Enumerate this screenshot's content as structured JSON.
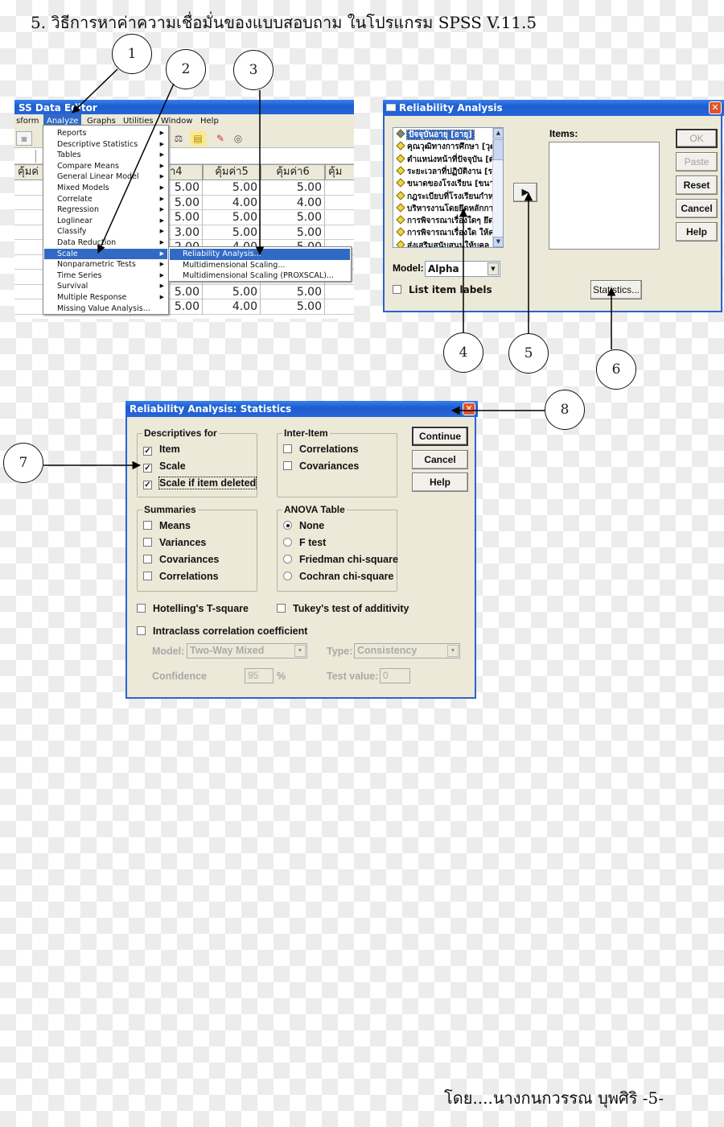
{
  "heading": "5.  วิธีการหาค่าความเชื่อมั่นของแบบสอบถาม  ในโปรแกรม SPSS V.11.5",
  "footer": "โดย....นางกนกวรรณ  บุพศิริ  -5-",
  "callouts": [
    "1",
    "2",
    "3",
    "4",
    "5",
    "6",
    "7",
    "8"
  ],
  "data_editor": {
    "title": "SS Data Editor",
    "menubar": [
      "sform",
      "Analyze",
      "Graphs",
      "Utilities",
      "Window",
      "Help"
    ],
    "active_menu": "Analyze",
    "toolbar_icons": [
      "chart-icon",
      "scale-balance-icon",
      "grid-table-icon",
      "value-labels-icon",
      "sets-icon"
    ],
    "columns": [
      "คุ้มค่",
      "า4",
      "คุ้มค่า5",
      "คุ้มค่า6",
      "คุ้ม"
    ],
    "rows": [
      [
        "5.00",
        "5.00",
        "5.00"
      ],
      [
        "5.00",
        "4.00",
        "4.00"
      ],
      [
        "5.00",
        "5.00",
        "5.00"
      ],
      [
        "3.00",
        "5.00",
        "5.00"
      ],
      [
        "2.00",
        "4.00",
        "5.00"
      ],
      [
        "",
        "",
        ""
      ],
      [
        "",
        "",
        ""
      ],
      [
        "5.00",
        "5.00",
        "5.00"
      ],
      [
        "5.00",
        "4.00",
        "5.00"
      ]
    ],
    "analyze_menu": [
      {
        "label": "Reports",
        "submenu": true
      },
      {
        "label": "Descriptive Statistics",
        "submenu": true
      },
      {
        "label": "Tables",
        "submenu": true
      },
      {
        "label": "Compare Means",
        "submenu": true
      },
      {
        "label": "General Linear Model",
        "submenu": true
      },
      {
        "label": "Mixed Models",
        "submenu": true
      },
      {
        "label": "Correlate",
        "submenu": true
      },
      {
        "label": "Regression",
        "submenu": true
      },
      {
        "label": "Loglinear",
        "submenu": true
      },
      {
        "label": "Classify",
        "submenu": true
      },
      {
        "label": "Data Reduction",
        "submenu": true
      },
      {
        "label": "Scale",
        "submenu": true,
        "selected": true
      },
      {
        "label": "Nonparametric Tests",
        "submenu": true
      },
      {
        "label": "Time Series",
        "submenu": true
      },
      {
        "label": "Survival",
        "submenu": true
      },
      {
        "label": "Multiple Response",
        "submenu": true
      },
      {
        "label": "Missing Value Analysis...",
        "submenu": false
      }
    ],
    "scale_submenu": [
      {
        "label": "Reliability Analysis...",
        "selected": true
      },
      {
        "label": "Multidimensional Scaling..."
      },
      {
        "label": "Multidimensional Scaling (PROXSCAL)..."
      }
    ]
  },
  "reliability_dialog": {
    "title": "Reliability Analysis",
    "variables": [
      "ปัจจุบันอายุ [อายุ]",
      "คุณวุฒิทางการศึกษา [วุฒิ",
      "ตำแหน่งหน้าที่ปัจจุบัน [ตำแ",
      "ระยะเวลาที่ปฏิบัติงาน [ระ",
      "ขนาดของโรงเรียน [ขนาด",
      "กฎระเบียบที่โรงเรียนกำห",
      "บริหารงานโดยยึดหลักกา",
      "การพิจารณาเรื่องใดๆ ยึด",
      "การพิจารณาเรื่องใด ให้ค",
      "ส่งเสริมสนับสนุนให้บุคล"
    ],
    "items_label": "Items:",
    "move_button": "▶",
    "buttons": {
      "ok": "OK",
      "paste": "Paste",
      "reset": "Reset",
      "cancel": "Cancel",
      "help": "Help"
    },
    "model_label": "Model:",
    "model_value": "Alpha",
    "list_item_labels": "List item labels",
    "list_item_labels_checked": false,
    "statistics_button": "Statistics..."
  },
  "statistics_dialog": {
    "title": "Reliability Analysis: Statistics",
    "descriptives": {
      "title": "Descriptives for",
      "options": [
        {
          "label": "Item",
          "checked": true
        },
        {
          "label": "Scale",
          "checked": true
        },
        {
          "label": "Scale if item deleted",
          "checked": true
        }
      ]
    },
    "inter_item": {
      "title": "Inter-Item",
      "options": [
        {
          "label": "Correlations",
          "checked": false
        },
        {
          "label": "Covariances",
          "checked": false
        }
      ]
    },
    "summaries": {
      "title": "Summaries",
      "options": [
        {
          "label": "Means",
          "checked": false
        },
        {
          "label": "Variances",
          "checked": false
        },
        {
          "label": "Covariances",
          "checked": false
        },
        {
          "label": "Correlations",
          "checked": false
        }
      ]
    },
    "anova": {
      "title": "ANOVA Table",
      "options": [
        {
          "label": "None",
          "selected": true
        },
        {
          "label": "F test",
          "selected": false
        },
        {
          "label": "Friedman chi-square",
          "selected": false
        },
        {
          "label": "Cochran chi-square",
          "selected": false
        }
      ]
    },
    "hotelling": {
      "label": "Hotelling's T-square",
      "checked": false
    },
    "tukey": {
      "label": "Tukey's test of additivity",
      "checked": false
    },
    "intraclass": {
      "label": "Intraclass correlation coefficient",
      "checked": false
    },
    "icc_model_label": "Model:",
    "icc_model_value": "Two-Way Mixed",
    "icc_type_label": "Type:",
    "icc_type_value": "Consistency",
    "confidence_label": "Confidence",
    "confidence_value": "95",
    "percent": "%",
    "test_value_label": "Test value:",
    "test_value": "0",
    "buttons": {
      "continue": "Continue",
      "cancel": "Cancel",
      "help": "Help"
    }
  }
}
